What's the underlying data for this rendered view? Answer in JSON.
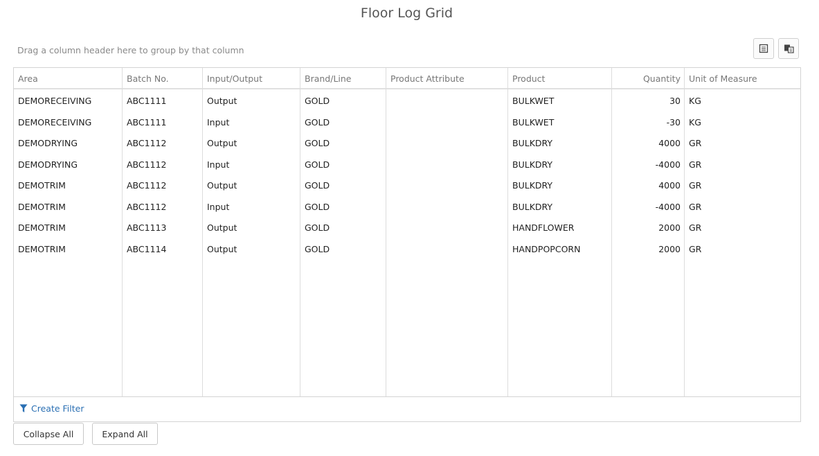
{
  "title": "Floor Log Grid",
  "group_panel": {
    "hint": "Drag a column header here to group by that column",
    "icons": [
      "export-csv-icon",
      "column-chooser-icon"
    ]
  },
  "columns": [
    "Area",
    "Batch No.",
    "Input/Output",
    "Brand/Line",
    "Product Attribute",
    "Product",
    "Quantity",
    "Unit of Measure"
  ],
  "rows": [
    [
      "DEMORECEIVING",
      "ABC1111",
      "Output",
      "GOLD",
      "",
      "BULKWET",
      "30",
      "KG"
    ],
    [
      "DEMORECEIVING",
      "ABC1111",
      "Input",
      "GOLD",
      "",
      "BULKWET",
      "-30",
      "KG"
    ],
    [
      "DEMODRYING",
      "ABC1112",
      "Output",
      "GOLD",
      "",
      "BULKDRY",
      "4000",
      "GR"
    ],
    [
      "DEMODRYING",
      "ABC1112",
      "Input",
      "GOLD",
      "",
      "BULKDRY",
      "-4000",
      "GR"
    ],
    [
      "DEMOTRIM",
      "ABC1112",
      "Output",
      "GOLD",
      "",
      "BULKDRY",
      "4000",
      "GR"
    ],
    [
      "DEMOTRIM",
      "ABC1112",
      "Input",
      "GOLD",
      "",
      "BULKDRY",
      "-4000",
      "GR"
    ],
    [
      "DEMOTRIM",
      "ABC1113",
      "Output",
      "GOLD",
      "",
      "HANDFLOWER",
      "2000",
      "GR"
    ],
    [
      "DEMOTRIM",
      "ABC1114",
      "Output",
      "GOLD",
      "",
      "HANDPOPCORN",
      "2000",
      "GR"
    ]
  ],
  "filter": {
    "label": "Create Filter",
    "icon": "funnel-icon",
    "color": "#2a6fb3"
  },
  "buttons": {
    "collapse_all": "Collapse All",
    "expand_all": "Expand All"
  }
}
